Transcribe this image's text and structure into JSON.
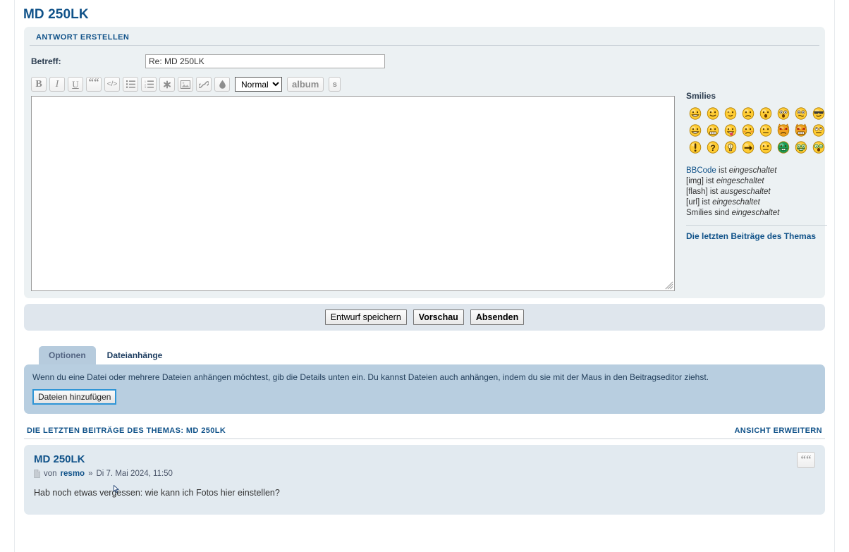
{
  "page": {
    "title": "MD 250LK"
  },
  "reply_panel": {
    "header": "ANTWORT ERSTELLEN",
    "subject_label": "Betreff:",
    "subject_value": "Re: MD 250LK",
    "subject_placeholder": "",
    "message_value": "",
    "message_placeholder": ""
  },
  "toolbar": {
    "bold": "B",
    "italic": "I",
    "underline": "U",
    "quote": "“",
    "code": "</>",
    "list_label": "list",
    "list_ordered_label": "list=",
    "asterisk": "*",
    "image_label": "img",
    "link_label": "url",
    "color_label": "color",
    "font_size_selected": "Normal",
    "font_size_options": [
      "Normal"
    ],
    "album_label": "album",
    "spoiler_label": "s"
  },
  "smilies": {
    "title": "Smilies",
    "items": [
      {
        "name": "smilie-grin",
        "face": "grin"
      },
      {
        "name": "smilie-smile",
        "face": "smile"
      },
      {
        "name": "smilie-wink",
        "face": "wink"
      },
      {
        "name": "smilie-sad",
        "face": "sad"
      },
      {
        "name": "smilie-surprised",
        "face": "surprised"
      },
      {
        "name": "smilie-shocked",
        "face": "shocked"
      },
      {
        "name": "smilie-confused",
        "face": "confused"
      },
      {
        "name": "smilie-cool",
        "face": "cool"
      },
      {
        "name": "smilie-laughing",
        "face": "laughing"
      },
      {
        "name": "smilie-mad",
        "face": "mad"
      },
      {
        "name": "smilie-razz",
        "face": "razz"
      },
      {
        "name": "smilie-embarrassed",
        "face": "embarrassed"
      },
      {
        "name": "smilie-neutral",
        "face": "neutral"
      },
      {
        "name": "smilie-evil",
        "face": "evil"
      },
      {
        "name": "smilie-twisted",
        "face": "twisted"
      },
      {
        "name": "smilie-rolleyes",
        "face": "rolleyes"
      },
      {
        "name": "smilie-exclaim",
        "face": "exclaim"
      },
      {
        "name": "smilie-question",
        "face": "question"
      },
      {
        "name": "smilie-idea",
        "face": "idea"
      },
      {
        "name": "smilie-arrow",
        "face": "arrow"
      },
      {
        "name": "smilie-neutral2",
        "face": "neutral2"
      },
      {
        "name": "smilie-green-grin",
        "face": "greengrin"
      },
      {
        "name": "smilie-geek",
        "face": "geek"
      },
      {
        "name": "smilie-ugeek",
        "face": "ugeek"
      }
    ]
  },
  "bbcode_info": {
    "lines": [
      {
        "link": "BBCode",
        "mid": " ist ",
        "em": "eingeschaltet"
      },
      {
        "link": "",
        "pre": "[img] ist ",
        "em": "eingeschaltet"
      },
      {
        "link": "",
        "pre": "[flash] ist ",
        "em": "ausgeschaltet"
      },
      {
        "link": "",
        "pre": "[url] ist ",
        "em": "eingeschaltet"
      },
      {
        "link": "",
        "pre": "Smilies sind ",
        "em": "eingeschaltet"
      }
    ],
    "last_posts_link": "Die letzten Beiträge des Themas"
  },
  "submit_bar": {
    "save_draft": "Entwurf speichern",
    "preview": "Vorschau",
    "submit": "Absenden"
  },
  "tabs": [
    {
      "label": "Optionen",
      "active": false
    },
    {
      "label": "Dateianhänge",
      "active": true
    }
  ],
  "attachments": {
    "text": "Wenn du eine Datei oder mehrere Dateien anhängen möchtest, gib die Details unten ein. Du kannst Dateien auch anhängen, indem du sie mit der Maus in den Beitragseditor ziehst.",
    "add_button": "Dateien hinzufügen"
  },
  "last_posts": {
    "header": "DIE LETZTEN BEITRÄGE DES THEMAS: MD 250LK",
    "expand_link": "ANSICHT ERWEITERN",
    "posts": [
      {
        "title": "MD 250LK",
        "meta_prefix": "von",
        "author": "resmo",
        "separator": "»",
        "date": "Di 7. Mai 2024, 11:50",
        "body": "Hab noch etwas vergessen: wie kann ich Fotos hier einstellen?",
        "quote_button": "“"
      }
    ]
  },
  "colors": {
    "accent": "#105289",
    "panel_bg": "#ecf1f3",
    "submit_bg": "#dfe6ed",
    "attach_bg": "#b8cee0",
    "post_bg": "#e2eaf0",
    "tab_inactive_bg": "#b6cbdd",
    "focus_border": "#2f95d6"
  }
}
